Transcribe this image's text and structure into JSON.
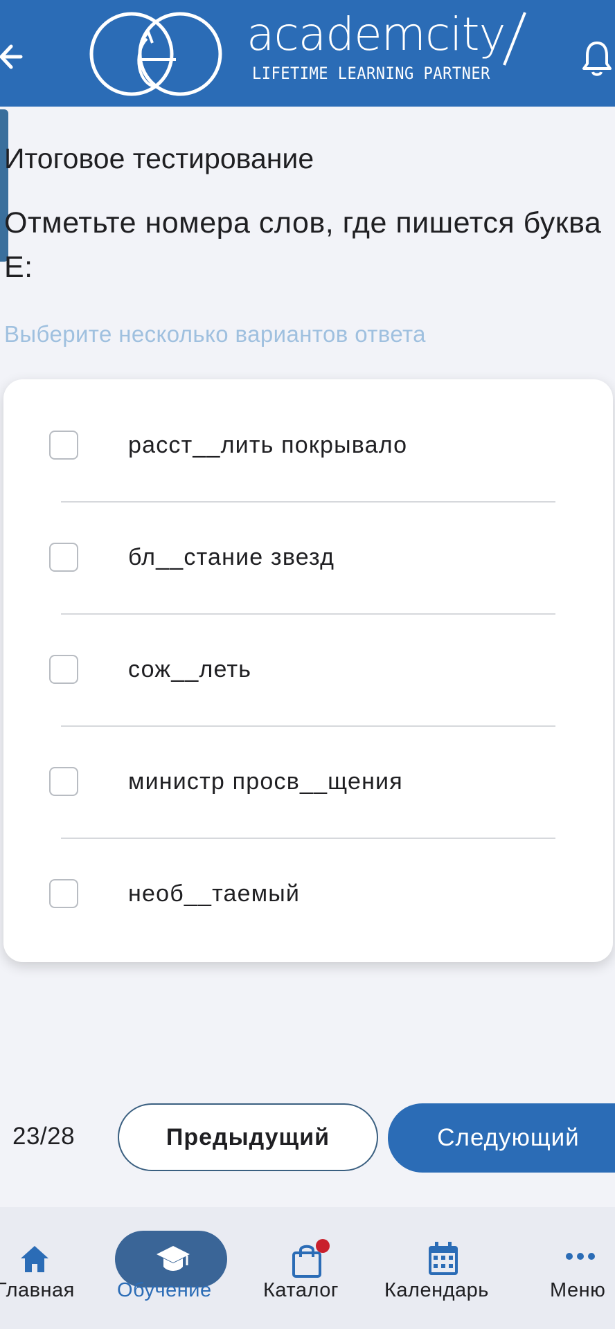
{
  "header": {
    "brand_name": "academcity",
    "brand_tagline": "LIFETIME LEARNING PARTNER",
    "back_icon": "arrow-left-icon",
    "bell_icon": "bell-icon"
  },
  "page": {
    "title": "Итоговое тестирование",
    "question": "Отметьте номера слов, где пишется буква Е:",
    "hint": "Выберите несколько вариантов ответа"
  },
  "options": [
    {
      "label": "расст__лить покрывало",
      "checked": false
    },
    {
      "label": "бл__стание звезд",
      "checked": false
    },
    {
      "label": "сож__леть",
      "checked": false
    },
    {
      "label": "министр просв__щения",
      "checked": false
    },
    {
      "label": "необ__таемый",
      "checked": false
    }
  ],
  "pagination": {
    "counter": "23/28",
    "prev_label": "Предыдущий",
    "next_label": "Следующий"
  },
  "nav": {
    "items": [
      {
        "label": "Главная",
        "icon": "home-icon",
        "active": false
      },
      {
        "label": "Обучение",
        "icon": "graduation-cap-icon",
        "active": true
      },
      {
        "label": "Каталог",
        "icon": "shopping-bag-icon",
        "active": false,
        "badge": true
      },
      {
        "label": "Календарь",
        "icon": "calendar-icon",
        "active": false
      },
      {
        "label": "Меню",
        "icon": "more-icon",
        "active": false
      }
    ]
  },
  "colors": {
    "brand": "#2b6cb6",
    "active_nav": "#3a6597",
    "hint": "#9fc0df",
    "badge": "#c9202c"
  }
}
